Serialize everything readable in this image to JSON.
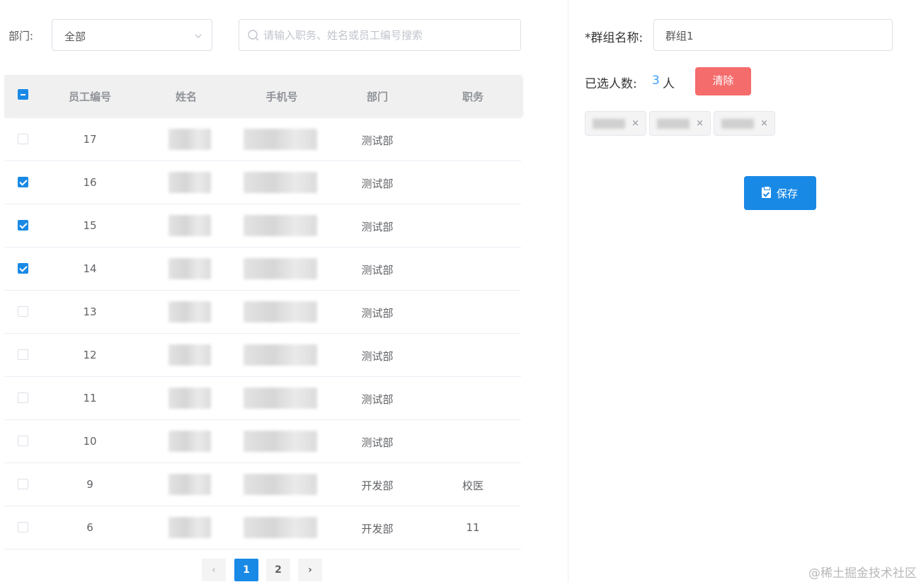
{
  "filter": {
    "dept_label": "部门:",
    "dept_value": "全部",
    "search_placeholder": "请输入职务、姓名或员工编号搜索"
  },
  "table": {
    "headers": [
      "员工编号",
      "姓名",
      "手机号",
      "部门",
      "职务"
    ],
    "rows": [
      {
        "id": "17",
        "dept": "测试部",
        "position": "",
        "checked": false
      },
      {
        "id": "16",
        "dept": "测试部",
        "position": "",
        "checked": true
      },
      {
        "id": "15",
        "dept": "测试部",
        "position": "",
        "checked": true
      },
      {
        "id": "14",
        "dept": "测试部",
        "position": "",
        "checked": true
      },
      {
        "id": "13",
        "dept": "测试部",
        "position": "",
        "checked": false
      },
      {
        "id": "12",
        "dept": "测试部",
        "position": "",
        "checked": false
      },
      {
        "id": "11",
        "dept": "测试部",
        "position": "",
        "checked": false
      },
      {
        "id": "10",
        "dept": "测试部",
        "position": "",
        "checked": false
      },
      {
        "id": "9",
        "dept": "开发部",
        "position": "校医",
        "checked": false
      },
      {
        "id": "6",
        "dept": "开发部",
        "position": "11",
        "checked": false
      }
    ]
  },
  "pagination": {
    "prev": "‹",
    "pages": [
      "1",
      "2"
    ],
    "next": "›",
    "current": "1"
  },
  "group": {
    "name_label": "*群组名称:",
    "name_value": "群组1",
    "count_label": "已选人数:",
    "count_value": "3",
    "count_unit": "人",
    "clear_label": "清除",
    "tag_close": "×",
    "save_label": "保存"
  },
  "watermark": "@稀土掘金技术社区",
  "colors": {
    "primary": "#1989e6",
    "danger": "#f56c6c",
    "count": "#409eff"
  }
}
